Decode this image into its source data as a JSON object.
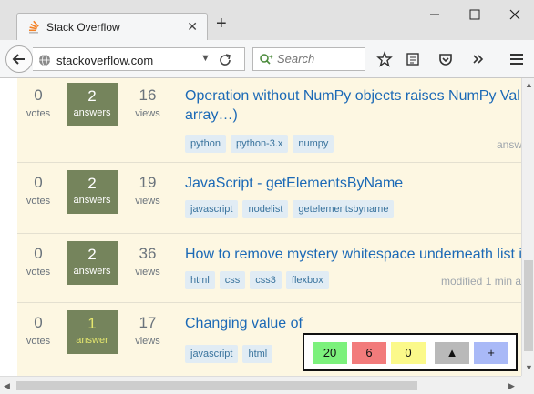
{
  "browser": {
    "tab_title": "Stack Overflow",
    "new_tab_label": "+",
    "url": "stackoverflow.com",
    "search_placeholder": "Search",
    "icons": [
      "stackoverflow-favicon",
      "close-icon",
      "minimize-icon",
      "maximize-icon",
      "back-icon",
      "globe-icon",
      "dropdown-icon",
      "reload-icon",
      "search-icon",
      "bookmark-star-icon",
      "reader-view-icon",
      "pocket-icon",
      "overflow-icon",
      "menu-icon"
    ]
  },
  "questions": [
    {
      "votes": "0",
      "votes_label": "votes",
      "answers": "2",
      "answers_label": "answers",
      "views": "16",
      "views_label": "views",
      "title": "Operation without NumPy objects raises NumPy Val… array…)",
      "tags": [
        "python",
        "python-3.x",
        "numpy"
      ],
      "meta": "answ"
    },
    {
      "votes": "0",
      "votes_label": "votes",
      "answers": "2",
      "answers_label": "answers",
      "views": "19",
      "views_label": "views",
      "title": "JavaScript - getElementsByName",
      "tags": [
        "javascript",
        "nodelist",
        "getelementsbyname"
      ],
      "meta": ""
    },
    {
      "votes": "0",
      "votes_label": "votes",
      "answers": "2",
      "answers_label": "answers",
      "views": "36",
      "views_label": "views",
      "title": "How to remove mystery whitespace underneath list i",
      "tags": [
        "html",
        "css",
        "css3",
        "flexbox"
      ],
      "meta": "modified 1 min a"
    },
    {
      "votes": "0",
      "votes_label": "votes",
      "answers": "1",
      "answers_label": "answer",
      "views": "17",
      "views_label": "views",
      "title": "Changing value of",
      "tags": [
        "javascript",
        "html"
      ],
      "meta": ""
    }
  ],
  "widget": {
    "green_count": "20",
    "red_count": "6",
    "yellow_count": "0",
    "up_label": "▲",
    "plus_label": "+",
    "colors": {
      "green": "#7cf17c",
      "red": "#f27b7b",
      "yellow": "#fbf98a",
      "gray": "#b9b9b9",
      "blue": "#a9b9f7"
    }
  },
  "colors": {
    "page_bg": "#fdf7e2",
    "accepted_answers": "#75845c",
    "title_link": "#1b69b6"
  }
}
